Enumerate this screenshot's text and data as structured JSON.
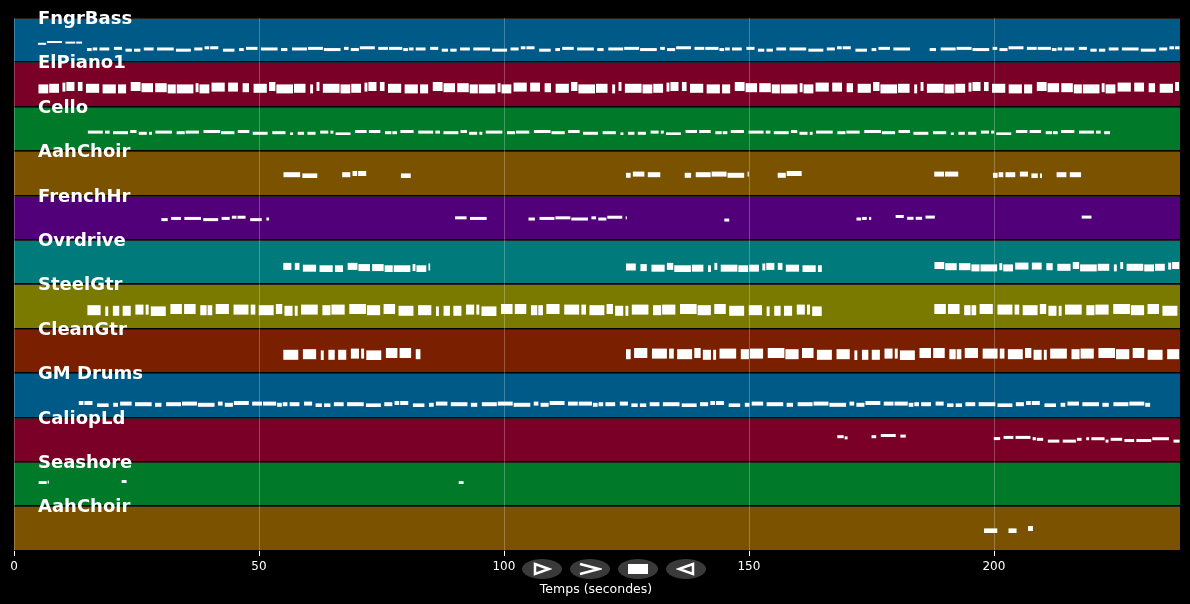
{
  "tracks": [
    {
      "name": "FngrBass",
      "color": "#005a87"
    },
    {
      "name": "ElPiano1",
      "color": "#7a0028"
    },
    {
      "name": "Cello",
      "color": "#007a28"
    },
    {
      "name": "AahChoir",
      "color": "#7a5200"
    },
    {
      "name": "FrenchHr",
      "color": "#52007a"
    },
    {
      "name": "Ovrdrive",
      "color": "#007a7a"
    },
    {
      "name": "SteelGtr",
      "color": "#7a7a00"
    },
    {
      "name": "CleanGtr",
      "color": "#7a2000"
    },
    {
      "name": "GM Drums",
      "color": "#005a87"
    },
    {
      "name": "CaliopLd",
      "color": "#7a0028"
    },
    {
      "name": "Seashore",
      "color": "#007a28"
    },
    {
      "name": "AahChoir",
      "color": "#7a5200"
    }
  ],
  "x_axis": {
    "ticks": [
      "0",
      "50",
      "100",
      "150",
      "200"
    ],
    "xlabel": "Temps (secondes)"
  },
  "controls": [
    {
      "kind": "play"
    },
    {
      "kind": "forward"
    },
    {
      "kind": "stop"
    },
    {
      "kind": "back"
    }
  ]
}
